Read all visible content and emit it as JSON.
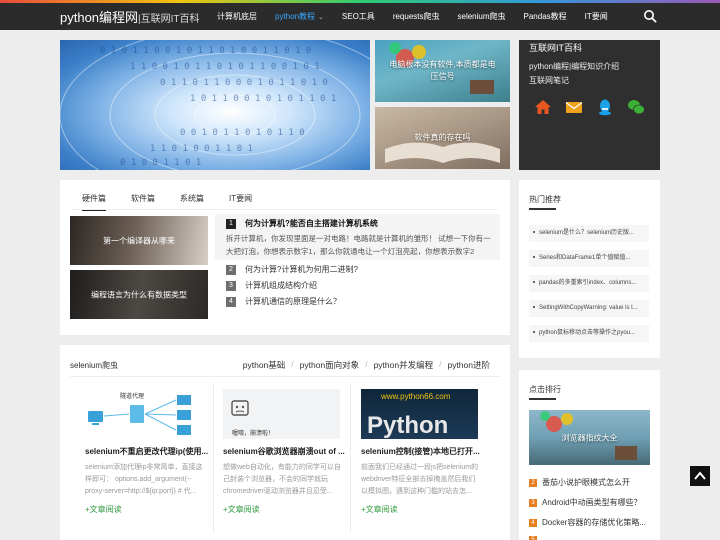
{
  "site": {
    "title": "python编程网",
    "subtitle": "|互联网IT百科"
  },
  "nav": {
    "items": [
      {
        "label": "计算机底层"
      },
      {
        "label": "python教程"
      },
      {
        "label": "SEO工具"
      },
      {
        "label": "requests爬虫"
      },
      {
        "label": "selenium爬虫"
      },
      {
        "label": "Pandas教程"
      },
      {
        "label": "IT要闻"
      }
    ],
    "active_color": "#3aa7ff",
    "icons": {
      "search": "search-icon",
      "dropdown": "chevron-down-icon"
    }
  },
  "hero": {
    "main_bits": [
      "0 1 0 1 1 0 0 1 0 1 1 0 1 0 0 1 1 0 1 0",
      "1 1 0 0 1 0 1 1 0 1 0 1 1 0 0 1 0 1",
      "0 1 1 0 1 1 0 0 0 1 0 1 1 0 1 0",
      "1 0 1 1 0 0 1 0 1 0 1 1 0 1",
      "0 0 1 0 1 1 0 1 0 1 1 0",
      "1 1 0 1 0 0 1 1 0 1",
      "0 1 0 0 1 1 0 1"
    ],
    "slides": [
      {
        "caption": "电脑根本没有软件,本质都是电压信号"
      },
      {
        "caption": "软件真的存在吗"
      }
    ]
  },
  "about": {
    "title": "互联网IT百科",
    "desc_line1": "python编程|编程知识介绍",
    "desc_line2": "互联网笔记",
    "icons": [
      "home-icon",
      "mail-icon",
      "qq-icon",
      "wechat-icon"
    ],
    "colors": {
      "home": "#e8571f",
      "mail": "#f0a21a",
      "qq": "#1aa1e8",
      "wechat": "#3cb034"
    }
  },
  "hardware": {
    "tabs": [
      {
        "label": "硬件篇"
      },
      {
        "label": "软件篇"
      },
      {
        "label": "系统篇"
      },
      {
        "label": "IT要闻"
      }
    ],
    "thumbs": [
      {
        "caption": "第一个编译器从哪来"
      },
      {
        "caption": "编程语言为什么有数据类型"
      }
    ],
    "questions": [
      {
        "num": "1",
        "title": "何为计算机?能否自主搭建计算机系统",
        "excerpt": "拆开计算机，你发现里面是一对电路！电路就是计算机的雏形！ 试想一下你有一大把灯泡，你想表示数字1，那么你就通电让一个灯泡亮起，你想表示数字2"
      },
      {
        "num": "2",
        "title": "何为计算?计算机为何用二进制?"
      },
      {
        "num": "3",
        "title": "计算机组成结构介绍"
      },
      {
        "num": "4",
        "title": "计算机通信的原理是什么？"
      }
    ]
  },
  "selenium": {
    "title": "selenium爬虫",
    "links": [
      {
        "label": "python基础"
      },
      {
        "label": "python面向对象"
      },
      {
        "label": "python并发编程"
      },
      {
        "label": "python进阶"
      }
    ],
    "cards": [
      {
        "title": "selenium不重启更改代理ip(使用...",
        "desc": "selenium添加代理ip非常简单，直接这样即可： options.add_argument(--proxy-server=http://${ip:port}) # 代...",
        "more": "+文章阅读",
        "img_label": "隧道代理"
      },
      {
        "title": "selenium谷歌浏览器崩溃out of ...",
        "desc": "想做web自动化，有能力的同学可以自己封装个浏览器，不会的同学就玩chromedriver驱动浏览器并且忍受...",
        "more": "+文章阅读",
        "img_label": "喔唷，崩溃啦！"
      },
      {
        "title": "selenium控制(接管)本地已打开...",
        "desc": "前面我们已经通过一段js把selenium的webdriver特征全部去掉掩盖然后我们以模拟图，遇到这种门槛的站去怎...",
        "more": "+文章阅读",
        "img_label": "www.python66.com",
        "img_label2": "Python"
      }
    ]
  },
  "hot": {
    "title": "热门推荐",
    "items": [
      {
        "label": "selenium是什么？selenium历史版..."
      },
      {
        "label": "Series和DataFrame1单个值赋值..."
      },
      {
        "label": "pandas的多重索引index、columns..."
      },
      {
        "label": "SettingWithCopyWarning: value is t..."
      },
      {
        "label": "python鼠标移动点击等操作之pyou..."
      }
    ]
  },
  "rank": {
    "title": "点击排行",
    "image_caption": "浏览器指纹大全",
    "items": [
      {
        "num": "2",
        "label": "番茄小说护眼模式怎么开"
      },
      {
        "num": "3",
        "label": "Android中动画类型有哪些？"
      },
      {
        "num": "4",
        "label": "Docker容器的存储优化策略..."
      },
      {
        "num": "5",
        "label": "..."
      }
    ],
    "num_color": "#e67e22"
  },
  "back_to_top": {
    "icon": "arrow-up-icon"
  }
}
